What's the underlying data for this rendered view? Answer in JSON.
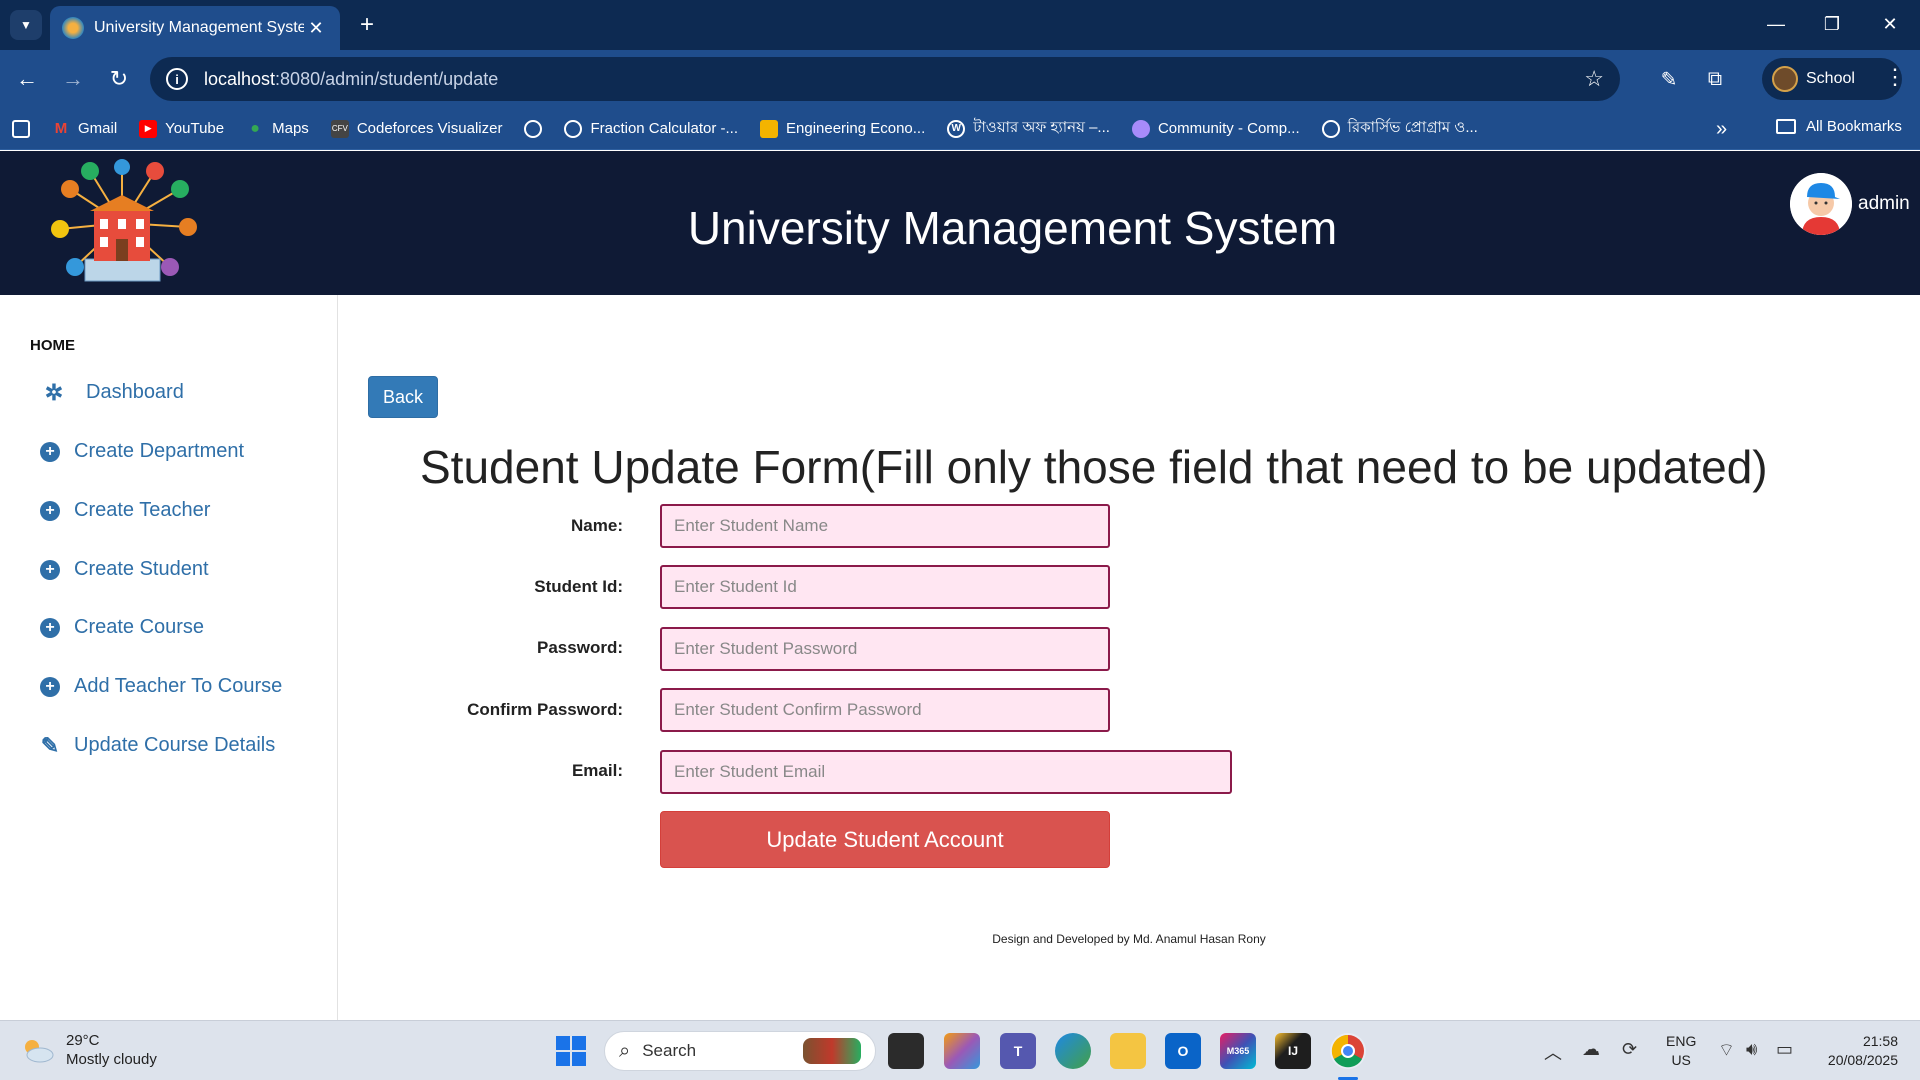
{
  "browser": {
    "tab_title": "University Management System",
    "url_host": "localhost",
    "url_path": ":8080/admin/student/update",
    "profile_label": "School",
    "bookmarks": [
      {
        "label": "Gmail",
        "icon": "gmail-icon",
        "color": "#ea4335"
      },
      {
        "label": "YouTube",
        "icon": "youtube-icon",
        "color": "#ff0000"
      },
      {
        "label": "Maps",
        "icon": "maps-icon",
        "color": "#34a853"
      },
      {
        "label": "Codeforces Visualizer",
        "icon": "cfv-icon",
        "color": "#444444"
      },
      {
        "label": "",
        "icon": "globe-icon",
        "color": "#ffffff"
      },
      {
        "label": "Fraction Calculator -...",
        "icon": "globe-icon",
        "color": "#ffffff"
      },
      {
        "label": "Engineering Econo...",
        "icon": "classroom-icon",
        "color": "#f4b400"
      },
      {
        "label": "টাওয়ার অফ হ্যানয় –...",
        "icon": "wordpress-icon",
        "color": "#ffffff"
      },
      {
        "label": "Community - Comp...",
        "icon": "community-icon",
        "color": "#a78bfa"
      },
      {
        "label": "রিকার্সিভ প্রোগ্রাম ও...",
        "icon": "globe-icon",
        "color": "#ffffff"
      }
    ],
    "all_bookmarks_label": "All Bookmarks"
  },
  "header": {
    "title": "University Management System",
    "user_name": "admin"
  },
  "sidebar": {
    "section_label": "HOME",
    "items": [
      {
        "label": "Dashboard",
        "icon": "dashboard-icon"
      },
      {
        "label": "Create Department",
        "icon": "plus-circle-icon"
      },
      {
        "label": "Create Teacher",
        "icon": "plus-circle-icon"
      },
      {
        "label": "Create Student",
        "icon": "plus-circle-icon"
      },
      {
        "label": "Create Course",
        "icon": "plus-circle-icon"
      },
      {
        "label": "Add Teacher To Course",
        "icon": "plus-circle-icon"
      },
      {
        "label": "Update Course Details",
        "icon": "edit-icon"
      }
    ]
  },
  "main": {
    "back_label": "Back",
    "form_title": "Student Update Form(Fill only those field that need to be updated)",
    "fields": [
      {
        "label": "Name:",
        "placeholder": "Enter Student Name"
      },
      {
        "label": "Student Id:",
        "placeholder": "Enter Student Id"
      },
      {
        "label": "Password:",
        "placeholder": "Enter Student Password"
      },
      {
        "label": "Confirm Password:",
        "placeholder": "Enter Student Confirm Password"
      },
      {
        "label": "Email:",
        "placeholder": "Enter Student Email"
      }
    ],
    "submit_label": "Update Student Account",
    "footer": "Design and Developed by Md. Anamul Hasan Rony"
  },
  "taskbar": {
    "temperature": "29°C",
    "weather": "Mostly cloudy",
    "search_label": "Search",
    "lang_top": "ENG",
    "lang_bottom": "US",
    "time": "21:58",
    "date": "20/08/2025"
  },
  "colors": {
    "header_bg": "#0f1a35",
    "accent_link": "#2f6fa8",
    "submit": "#d9534f",
    "back": "#337ab7",
    "input_bg": "#ffe6f2"
  }
}
